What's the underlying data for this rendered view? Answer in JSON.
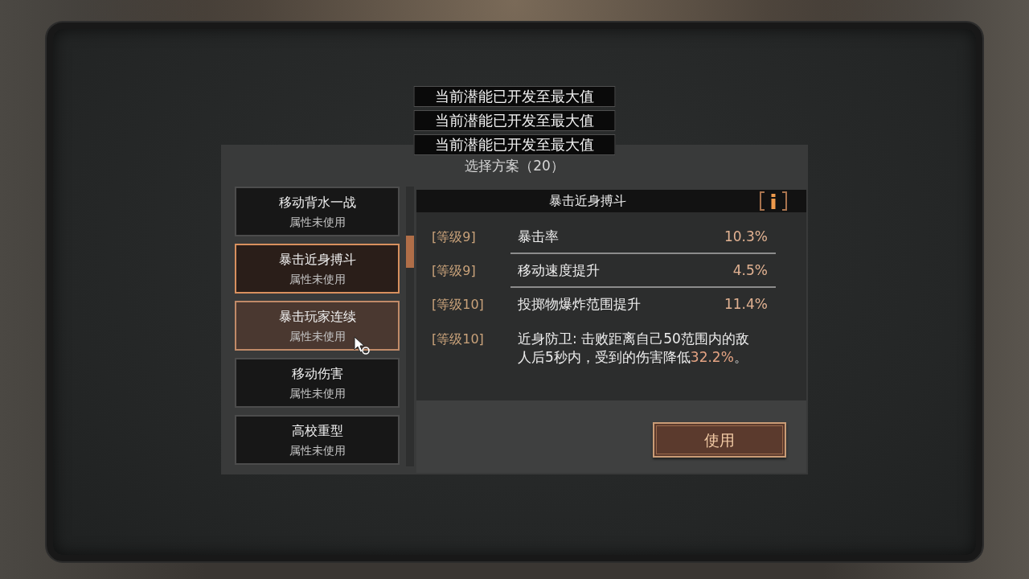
{
  "toasts": [
    "当前潜能已开发至最大值",
    "当前潜能已开发至最大值",
    "当前潜能已开发至最大值"
  ],
  "dialog": {
    "title": "选择方案（20）",
    "plans": [
      {
        "name": "移动背水一战",
        "status": "属性未使用",
        "selected": false,
        "hovered": false
      },
      {
        "name": "暴击近身搏斗",
        "status": "属性未使用",
        "selected": true,
        "hovered": false
      },
      {
        "name": "暴击玩家连续",
        "status": "属性未使用",
        "selected": false,
        "hovered": true
      },
      {
        "name": "移动伤害",
        "status": "属性未使用",
        "selected": false,
        "hovered": false
      },
      {
        "name": "高校重型",
        "status": "属性未使用",
        "selected": false,
        "hovered": false
      }
    ],
    "detail": {
      "title": "暴击近身搏斗",
      "effects": [
        {
          "kind": "stat",
          "grade": "[等级9]",
          "name": "暴击率",
          "value": "10.3%",
          "underlined": true
        },
        {
          "kind": "stat",
          "grade": "[等级9]",
          "name": "移动速度提升",
          "value": "4.5%",
          "underlined": true
        },
        {
          "kind": "stat",
          "grade": "[等级10]",
          "name": "投掷物爆炸范围提升",
          "value": "11.4%",
          "underlined": false
        },
        {
          "kind": "effect",
          "grade": "[等级10]",
          "text": "近身防卫: 击败距离自己50范围内的敌人后5秒内，受到的伤害降低",
          "highlight": "32.2%",
          "suffix": "。"
        }
      ]
    },
    "button": "使用"
  }
}
